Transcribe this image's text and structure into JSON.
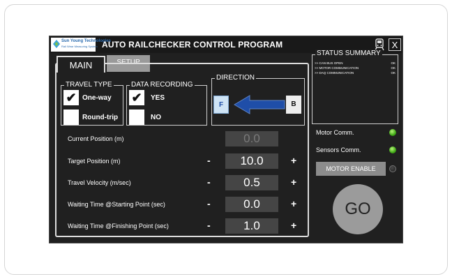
{
  "window": {
    "title": "AUTO RAILCHECKER CONTROL PROGRAM",
    "logo_line1": "Sun Young Technologies",
    "logo_line2": "Rail Wear Measuring System",
    "close_label": "X"
  },
  "tabs": {
    "main": "MAIN",
    "setup": "SETUP"
  },
  "travel_type": {
    "label": "TRAVEL TYPE",
    "options": [
      {
        "label": "One-way",
        "checked": true
      },
      {
        "label": "Round-trip",
        "checked": false
      }
    ]
  },
  "data_recording": {
    "label": "DATA RECORDING",
    "options": [
      {
        "label": "YES",
        "checked": true
      },
      {
        "label": "NO",
        "checked": false
      }
    ]
  },
  "direction": {
    "label": "DIRECTION",
    "forward": "F",
    "backward": "B",
    "selected": "F"
  },
  "params": [
    {
      "label": "Current Position (m)",
      "value": "0.0",
      "editable": false
    },
    {
      "label": "Target Position (m)",
      "value": "10.0",
      "editable": true
    },
    {
      "label": "Travel Velocity (m/sec)",
      "value": "0.5",
      "editable": true
    },
    {
      "label": "Waiting Time @Starting Point (sec)",
      "value": "0.0",
      "editable": true
    },
    {
      "label": "Waiting Time @Finishing Point (sec)",
      "value": "1.0",
      "editable": true
    }
  ],
  "stepper": {
    "minus": "-",
    "plus": "+"
  },
  "status_summary": {
    "label": "STATUS SUMMARY",
    "lines": [
      {
        "text": ">> CAN BUS OPEN",
        "status": "OK"
      },
      {
        "text": ">> MOTOR COMMUNICATION",
        "status": "OK"
      },
      {
        "text": ">> DAQ COMMUNICATION",
        "status": "OK"
      }
    ]
  },
  "comms": {
    "motor": "Motor Comm.",
    "sensors": "Sensors Comm."
  },
  "motor_enable": "MOTOR ENABLE",
  "go": "GO",
  "colors": {
    "led_on": "#3ea815",
    "go_button": "#9b9b9b",
    "arrow": "#1f4ea8"
  }
}
